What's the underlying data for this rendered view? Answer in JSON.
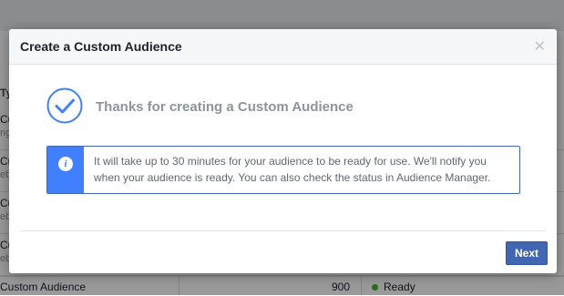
{
  "background": {
    "rows": [
      {
        "name": "Cus",
        "sub": "ng"
      },
      {
        "name": "Cus",
        "sub": "eb"
      },
      {
        "name": "Cus",
        "sub": "eb"
      },
      {
        "name": "Cus",
        "sub": "eb"
      }
    ],
    "header_fragment": "Typ",
    "last_row": {
      "name": "Custom Audience",
      "size": "900",
      "status": "Ready"
    }
  },
  "dialog": {
    "title": "Create a Custom Audience",
    "close_icon": "close-icon",
    "heading": "Thanks for creating a Custom Audience",
    "info_text": "It will take up to 30 minutes for your audience to be ready for use. We'll notify you when your audience is ready. You can also check the status in Audience Manager.",
    "next_label": "Next"
  },
  "colors": {
    "accent": "#4267b2",
    "info_side": "#4080ff",
    "ready": "#42b72a"
  }
}
